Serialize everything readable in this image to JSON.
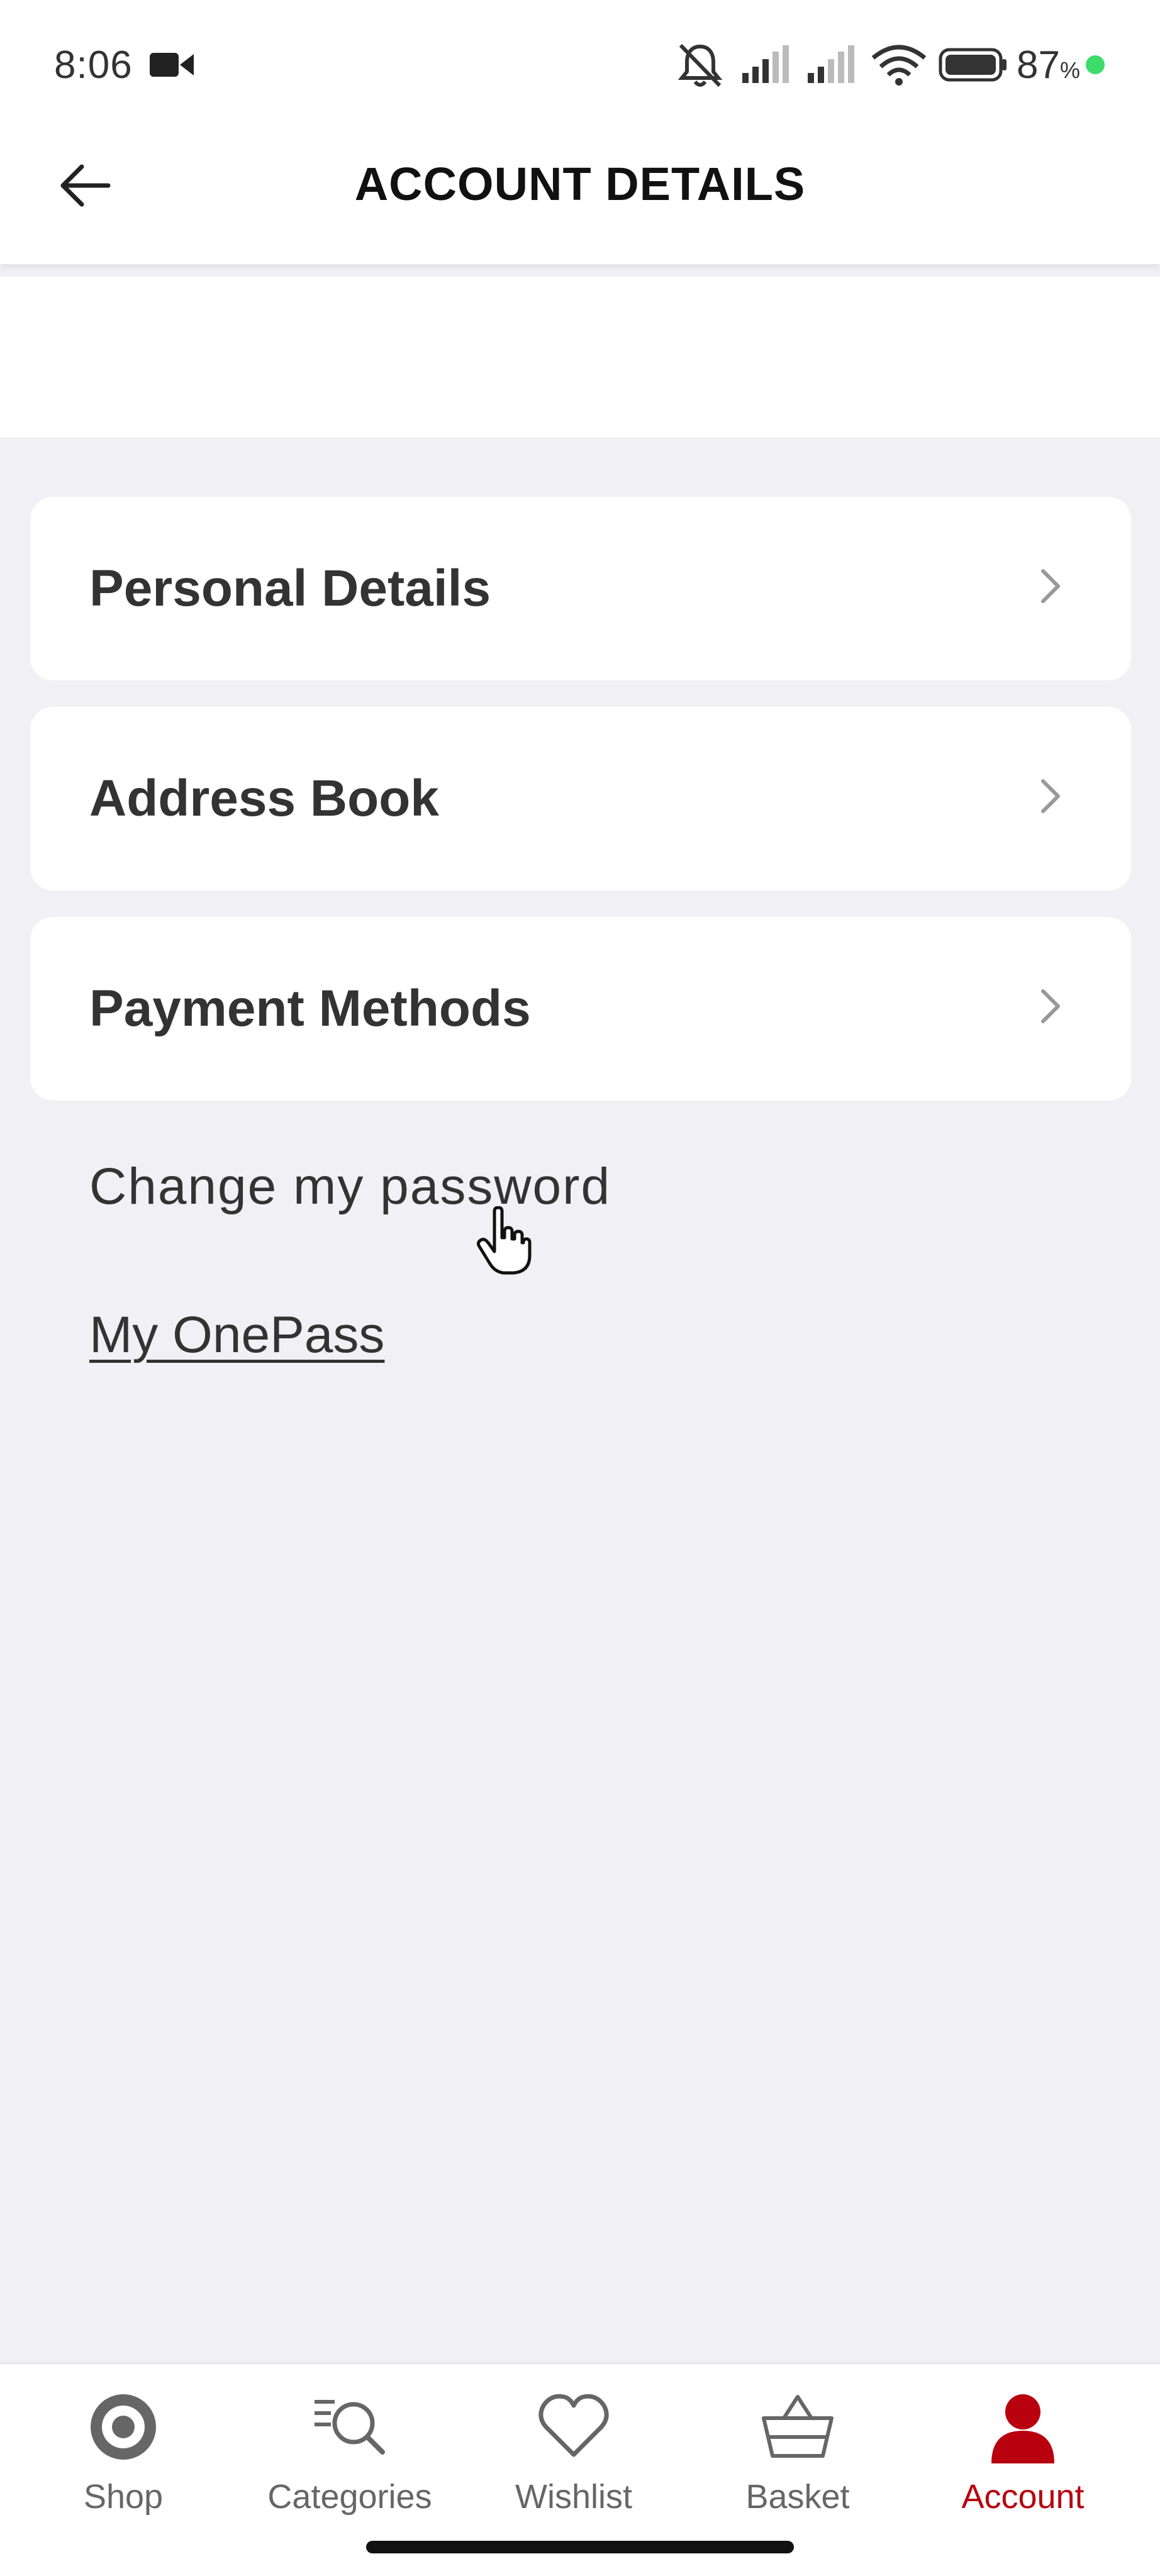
{
  "status_bar": {
    "time": "8:06",
    "battery_level": "87",
    "battery_unit": "%",
    "icons": [
      "camera-icon",
      "mute-icon",
      "signal-icon",
      "signal-icon",
      "wifi-icon",
      "battery-icon"
    ]
  },
  "header": {
    "title": "ACCOUNT DETAILS",
    "back_icon": "arrow-left-icon"
  },
  "menu": {
    "items": [
      {
        "label": "Personal Details"
      },
      {
        "label": "Address Book"
      },
      {
        "label": "Payment Methods"
      }
    ]
  },
  "links": {
    "change_password": "Change my password",
    "onepass": "My OnePass"
  },
  "bottom_nav": {
    "items": [
      {
        "label": "Shop",
        "icon": "target-icon"
      },
      {
        "label": "Categories",
        "icon": "categories-search-icon"
      },
      {
        "label": "Wishlist",
        "icon": "heart-icon"
      },
      {
        "label": "Basket",
        "icon": "basket-icon"
      },
      {
        "label": "Account",
        "icon": "person-icon"
      }
    ],
    "active": "Account"
  },
  "colors": {
    "accent": "#b8000e",
    "background": "#f0f0f5",
    "card": "#ffffff",
    "text": "#333333",
    "charging": "#3ddc6a"
  }
}
